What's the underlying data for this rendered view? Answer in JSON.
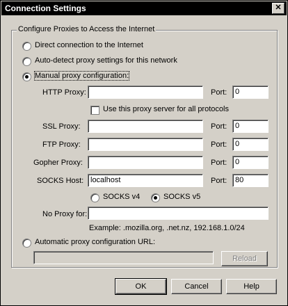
{
  "window": {
    "title": "Connection Settings",
    "close_glyph": "✕"
  },
  "group": {
    "label": "Configure Proxies to Access the Internet"
  },
  "options": {
    "direct": "Direct connection to the Internet",
    "auto_detect": "Auto-detect proxy settings for this network",
    "manual": "Manual proxy configuration:",
    "auto_url": "Automatic proxy configuration URL:"
  },
  "http": {
    "label": "HTTP Proxy:",
    "value": "",
    "port_label": "Port:",
    "port": "0"
  },
  "share": {
    "label": "Use this proxy server for all protocols"
  },
  "ssl": {
    "label": "SSL Proxy:",
    "value": "",
    "port_label": "Port:",
    "port": "0"
  },
  "ftp": {
    "label": "FTP Proxy:",
    "value": "",
    "port_label": "Port:",
    "port": "0"
  },
  "gopher": {
    "label": "Gopher Proxy:",
    "value": "",
    "port_label": "Port:",
    "port": "0"
  },
  "socks": {
    "label": "SOCKS Host:",
    "value": "localhost",
    "port_label": "Port:",
    "port": "80",
    "v4": "SOCKS v4",
    "v5": "SOCKS v5"
  },
  "noproxy": {
    "label": "No Proxy for:",
    "value": "",
    "example": "Example: .mozilla.org, .net.nz, 192.168.1.0/24"
  },
  "autourl": {
    "value": ""
  },
  "buttons": {
    "reload": "Reload",
    "ok": "OK",
    "cancel": "Cancel",
    "help": "Help"
  }
}
